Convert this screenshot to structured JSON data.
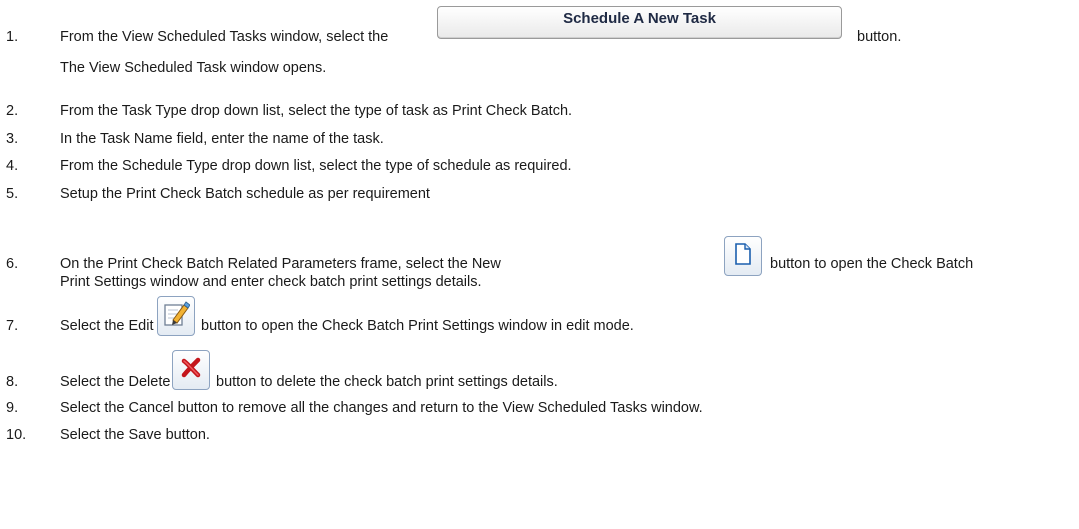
{
  "steps": [
    {
      "num": "1.",
      "before": "From the View Scheduled Tasks window, select the",
      "button_label": "Schedule A New Task",
      "after": "button.",
      "sub": "The View Scheduled Task window opens."
    },
    {
      "num": "2.",
      "text": "From the Task Type drop down list, select the type of task as Print Check Batch."
    },
    {
      "num": "3.",
      "text": "In the Task Name field, enter the name of the task."
    },
    {
      "num": "4.",
      "text": "From the Schedule Type drop down list, select the type of schedule as required."
    },
    {
      "num": "5.",
      "text": "Setup the Print Check Batch schedule as per requirement"
    },
    {
      "num": "6.",
      "before": "On the Print Check Batch Related Parameters frame, select the New",
      "after": "button to open the Check Batch",
      "line2": "Print Settings window and enter check batch print settings details.",
      "icon": "new-document-icon"
    },
    {
      "num": "7.",
      "before": "Select the Edit",
      "after": "button to open the Check Batch Print Settings window in edit mode.",
      "icon": "edit-pencil-icon"
    },
    {
      "num": "8.",
      "before": "Select the Delete",
      "after": "button to delete the check batch print settings details.",
      "icon": "delete-x-icon"
    },
    {
      "num": "9.",
      "text": "Select the Cancel button to remove all the changes and return to the View Scheduled Tasks window."
    },
    {
      "num": "10.",
      "text": "Select the Save button."
    }
  ]
}
